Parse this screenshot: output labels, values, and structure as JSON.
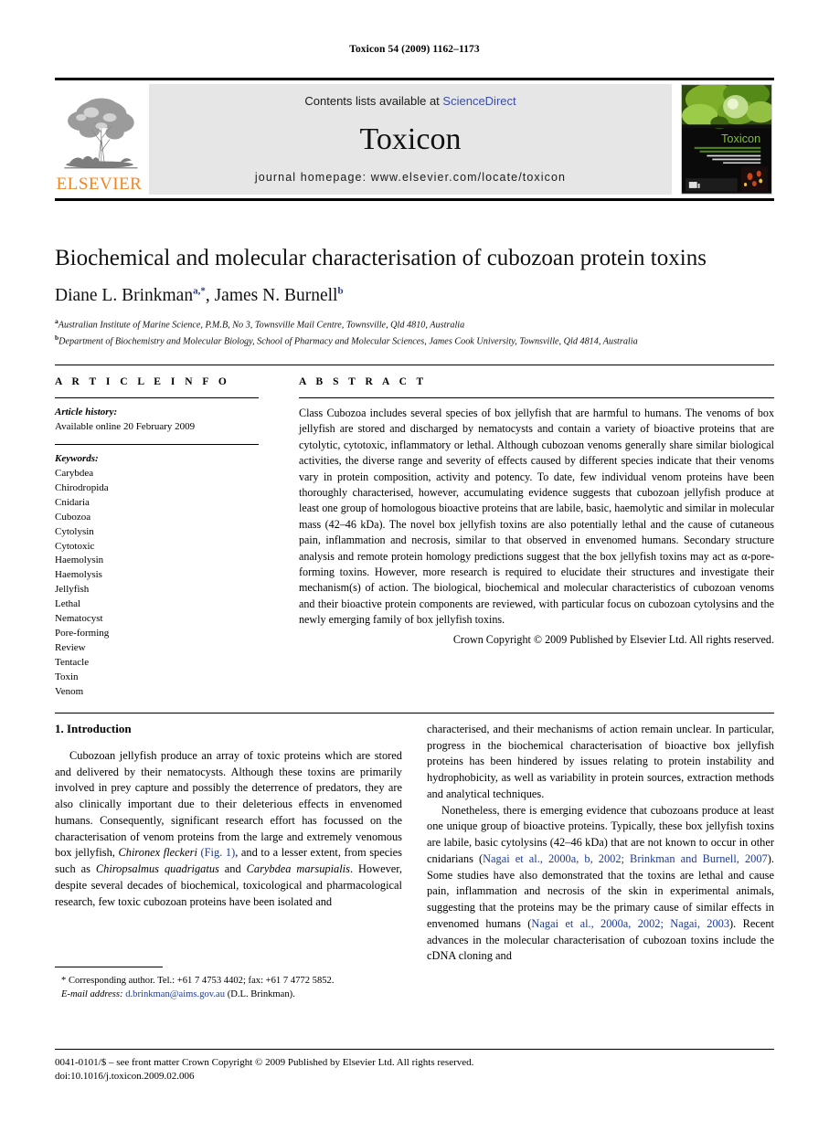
{
  "running_head": "Toxicon 54 (2009) 1162–1173",
  "banner": {
    "contents_prefix": "Contents lists available at",
    "contents_link": "ScienceDirect",
    "journal_name": "Toxicon",
    "homepage_label": "journal homepage: www.elsevier.com/locate/toxicon",
    "publisher_wordmark": "ELSEVIER",
    "cover_title": "Toxicon",
    "colors": {
      "elsevier_orange": "#F08521",
      "link_blue": "#3a4ea8",
      "banner_grey": "#e6e6e6",
      "cover_green": "#6ea82a",
      "citation_blue": "#1f3a93"
    }
  },
  "article": {
    "title": "Biochemical and molecular characterisation of cubozoan protein toxins",
    "authors": [
      {
        "name": "Diane L. Brinkman",
        "marks": "a,*"
      },
      {
        "name": "James N. Burnell",
        "marks": "b"
      }
    ],
    "affiliations": [
      {
        "mark": "a",
        "text": "Australian Institute of Marine Science, P.M.B, No 3, Townsville Mail Centre, Townsville, Qld 4810, Australia"
      },
      {
        "mark": "b",
        "text": "Department of Biochemistry and Molecular Biology, School of Pharmacy and Molecular Sciences, James Cook University, Townsville, Qld 4814, Australia"
      }
    ]
  },
  "info": {
    "heading": "A R T I C L E   I N F O",
    "history_label": "Article history:",
    "history_text": "Available online 20 February 2009",
    "keywords_label": "Keywords:",
    "keywords": [
      "Carybdea",
      "Chirodropida",
      "Cnidaria",
      "Cubozoa",
      "Cytolysin",
      "Cytotoxic",
      "Haemolysin",
      "Haemolysis",
      "Jellyfish",
      "Lethal",
      "Nematocyst",
      "Pore-forming",
      "Review",
      "Tentacle",
      "Toxin",
      "Venom"
    ]
  },
  "abstract": {
    "heading": "A B S T R A C T",
    "text": "Class Cubozoa includes several species of box jellyfish that are harmful to humans. The venoms of box jellyfish are stored and discharged by nematocysts and contain a variety of bioactive proteins that are cytolytic, cytotoxic, inflammatory or lethal. Although cubozoan venoms generally share similar biological activities, the diverse range and severity of effects caused by different species indicate that their venoms vary in protein composition, activity and potency. To date, few individual venom proteins have been thoroughly characterised, however, accumulating evidence suggests that cubozoan jellyfish produce at least one group of homologous bioactive proteins that are labile, basic, haemolytic and similar in molecular mass (42–46 kDa). The novel box jellyfish toxins are also potentially lethal and the cause of cutaneous pain, inflammation and necrosis, similar to that observed in envenomed humans. Secondary structure analysis and remote protein homology predictions suggest that the box jellyfish toxins may act as α-pore-forming toxins. However, more research is required to elucidate their structures and investigate their mechanism(s) of action. The biological, biochemical and molecular characteristics of cubozoan venoms and their bioactive protein components are reviewed, with particular focus on cubozoan cytolysins and the newly emerging family of box jellyfish toxins.",
    "copyright": "Crown Copyright © 2009 Published by Elsevier Ltd. All rights reserved."
  },
  "body": {
    "section_title": "1. Introduction",
    "left_p1_a": "Cubozoan jellyfish produce an array of toxic proteins which are stored and delivered by their nematocysts. Although these toxins are primarily involved in prey capture and possibly the deterrence of predators, they are also clinically important due to their deleterious effects in envenomed humans. Consequently, significant research effort has focussed on the characterisation of venom proteins from the large and extremely venomous box jellyfish, ",
    "left_species_1": "Chironex fleckeri",
    "left_cite_1": "(Fig. 1)",
    "left_p1_b": ", and to a lesser extent, from species such as ",
    "left_species_2": "Chiropsalmus quadrigatus",
    "left_p1_c": " and ",
    "left_species_3": "Carybdea marsupialis",
    "left_p1_d": ". However, despite several decades of biochemical, toxicological and pharmacological research, few toxic cubozoan proteins have been isolated and",
    "right_p1": "characterised, and their mechanisms of action remain unclear. In particular, progress in the biochemical characterisation of bioactive box jellyfish proteins has been hindered by issues relating to protein instability and hydrophobicity, as well as variability in protein sources, extraction methods and analytical techniques.",
    "right_p2_a": "Nonetheless, there is emerging evidence that cubozoans produce at least one unique group of bioactive proteins. Typically, these box jellyfish toxins are labile, basic cytolysins (42–46 kDa) that are not known to occur in other cnidarians (",
    "right_cite_1": "Nagai et al., 2000a, b, 2002; Brinkman and Burnell, 2007",
    "right_p2_b": "). Some studies have also demonstrated that the toxins are lethal and cause pain, inflammation and necrosis of the skin in experimental animals, suggesting that the proteins may be the primary cause of similar effects in envenomed humans (",
    "right_cite_2": "Nagai et al., 2000a, 2002; Nagai, 2003",
    "right_p2_c": "). Recent advances in the molecular characterisation of cubozoan toxins include the cDNA cloning and"
  },
  "footnote": {
    "marker": "*",
    "corresponding": "Corresponding author. Tel.: +61 7 4753 4402; fax: +61 7 4772 5852.",
    "email_label": "E-mail address:",
    "email": "d.brinkman@aims.gov.au",
    "email_suffix": "(D.L. Brinkman)."
  },
  "footer": {
    "issn_line": "0041-0101/$ – see front matter Crown Copyright © 2009 Published by Elsevier Ltd. All rights reserved.",
    "doi_line": "doi:10.1016/j.toxicon.2009.02.006"
  }
}
